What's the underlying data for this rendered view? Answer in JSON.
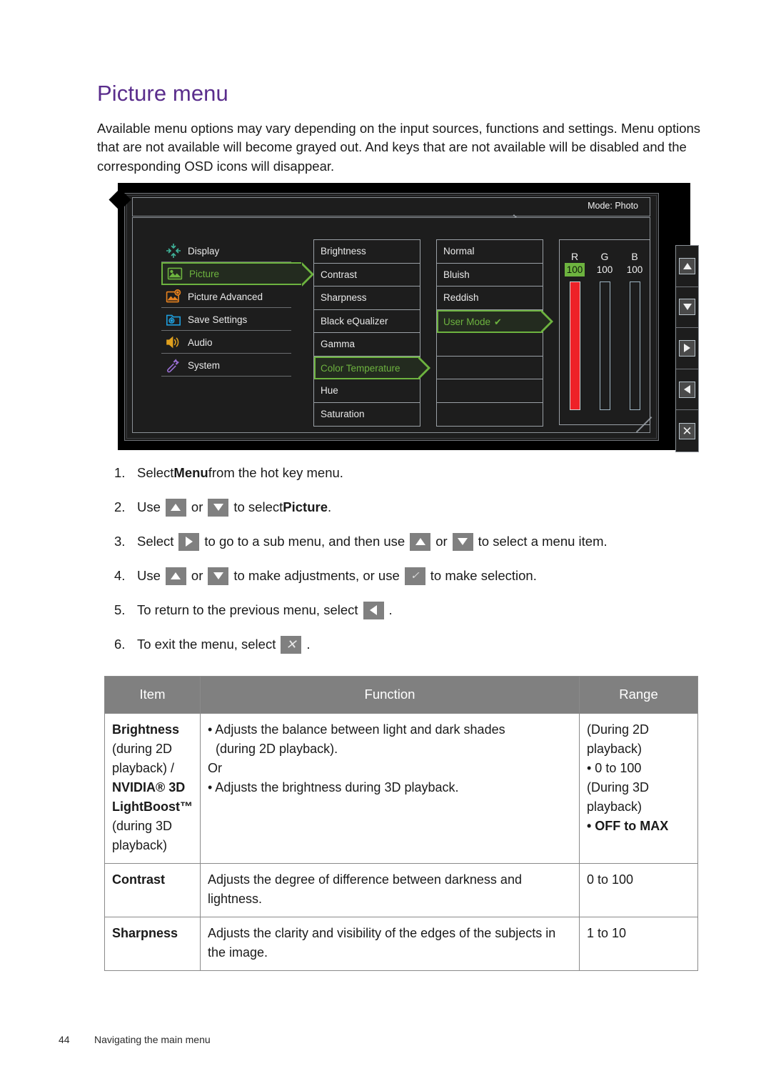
{
  "page": {
    "title": "Picture menu",
    "intro": "Available menu options may vary depending on the input sources, functions and settings. Menu options that are not available will become grayed out. And keys that are not available will be disabled and the corresponding OSD icons will disappear.",
    "footer_page_number": "44",
    "footer_text": "Navigating the main menu",
    "title_color": "#5a2d8c"
  },
  "osd": {
    "mode_label": "Mode: Photo",
    "highlight_color": "#6db33f",
    "sidebar": [
      {
        "label": "Display",
        "icon": "display-shrink-icon",
        "color": "#3fb39a",
        "selected": false
      },
      {
        "label": "Picture",
        "icon": "picture-image-icon",
        "color": "#6db33f",
        "selected": true
      },
      {
        "label": "Picture Advanced",
        "icon": "picture-advanced-icon",
        "color": "#e8821e",
        "selected": false
      },
      {
        "label": "Save Settings",
        "icon": "save-folder-icon",
        "color": "#1e9ddb",
        "selected": false
      },
      {
        "label": "Audio",
        "icon": "speaker-icon",
        "color": "#e0a01e",
        "selected": false
      },
      {
        "label": "System",
        "icon": "wrench-icon",
        "color": "#9a6fd4",
        "selected": false
      }
    ],
    "submenu": [
      {
        "label": "Brightness",
        "selected": false
      },
      {
        "label": "Contrast",
        "selected": false
      },
      {
        "label": "Sharpness",
        "selected": false
      },
      {
        "label": "Black eQualizer",
        "selected": false
      },
      {
        "label": "Gamma",
        "selected": false
      },
      {
        "label": "Color Temperature",
        "selected": true
      },
      {
        "label": "Hue",
        "selected": false
      },
      {
        "label": "Saturation",
        "selected": false
      }
    ],
    "options": [
      {
        "label": "Normal",
        "selected": false,
        "checked": false
      },
      {
        "label": "Bluish",
        "selected": false,
        "checked": false
      },
      {
        "label": "Reddish",
        "selected": false,
        "checked": false
      },
      {
        "label": "User Mode",
        "selected": true,
        "checked": true
      },
      {
        "label": "",
        "selected": false,
        "checked": false
      },
      {
        "label": "",
        "selected": false,
        "checked": false
      },
      {
        "label": "",
        "selected": false,
        "checked": false
      },
      {
        "label": "",
        "selected": false,
        "checked": false
      }
    ],
    "rgb": [
      {
        "letter": "R",
        "value": "100",
        "highlighted": true,
        "bar_filled": true,
        "bar_color": "#ee2128"
      },
      {
        "letter": "G",
        "value": "100",
        "highlighted": false,
        "bar_filled": false,
        "bar_color": "#9fb6c4"
      },
      {
        "letter": "B",
        "value": "100",
        "highlighted": false,
        "bar_filled": false,
        "bar_color": "#9fb6c4"
      }
    ],
    "controls": [
      {
        "icon": "arrow-up-icon"
      },
      {
        "icon": "arrow-down-icon"
      },
      {
        "icon": "arrow-right-icon"
      },
      {
        "icon": "arrow-left-icon"
      },
      {
        "icon": "close-x-icon"
      }
    ]
  },
  "steps": [
    {
      "num": "1.",
      "parts": [
        {
          "t": "text",
          "v": "Select "
        },
        {
          "t": "bold",
          "v": "Menu"
        },
        {
          "t": "text",
          "v": " from the hot key menu."
        }
      ]
    },
    {
      "num": "2.",
      "parts": [
        {
          "t": "text",
          "v": "Use "
        },
        {
          "t": "key",
          "v": "arrow-up-icon"
        },
        {
          "t": "text",
          "v": " or "
        },
        {
          "t": "key",
          "v": "arrow-down-icon"
        },
        {
          "t": "text",
          "v": " to select "
        },
        {
          "t": "bold",
          "v": "Picture"
        },
        {
          "t": "text",
          "v": "."
        }
      ]
    },
    {
      "num": "3.",
      "parts": [
        {
          "t": "text",
          "v": "Select "
        },
        {
          "t": "key",
          "v": "arrow-right-icon"
        },
        {
          "t": "text",
          "v": " to go to a sub menu, and then use "
        },
        {
          "t": "key",
          "v": "arrow-up-icon"
        },
        {
          "t": "text",
          "v": " or "
        },
        {
          "t": "key",
          "v": "arrow-down-icon"
        },
        {
          "t": "text",
          "v": " to select a menu item."
        }
      ]
    },
    {
      "num": "4.",
      "parts": [
        {
          "t": "text",
          "v": "Use "
        },
        {
          "t": "key",
          "v": "arrow-up-icon"
        },
        {
          "t": "text",
          "v": " or "
        },
        {
          "t": "key",
          "v": "arrow-down-icon"
        },
        {
          "t": "text",
          "v": " to make adjustments, or use "
        },
        {
          "t": "key",
          "v": "check-icon"
        },
        {
          "t": "text",
          "v": " to make selection."
        }
      ]
    },
    {
      "num": "5.",
      "parts": [
        {
          "t": "text",
          "v": "To return to the previous menu, select "
        },
        {
          "t": "key",
          "v": "arrow-left-icon"
        },
        {
          "t": "text",
          "v": "."
        }
      ]
    },
    {
      "num": "6.",
      "parts": [
        {
          "t": "text",
          "v": "To exit the menu, select "
        },
        {
          "t": "key",
          "v": "close-x-icon"
        },
        {
          "t": "text",
          "v": "."
        }
      ]
    }
  ],
  "table": {
    "headers": [
      "Item",
      "Function",
      "Range"
    ],
    "rows": [
      {
        "item_lines": [
          {
            "v": "Brightness",
            "bold": true
          },
          {
            "v": "(during 2D",
            "bold": false
          },
          {
            "v": "playback) /",
            "bold": false
          },
          {
            "v": "NVIDIA® 3D",
            "bold": true
          },
          {
            "v": "LightBoost™",
            "bold": true
          },
          {
            "v": "(during 3D",
            "bold": false
          },
          {
            "v": "playback)",
            "bold": false
          }
        ],
        "function_lines": [
          {
            "style": "bullet",
            "v": "Adjusts the balance between light and dark shades"
          },
          {
            "style": "sub",
            "v": "(during 2D playback)."
          },
          {
            "style": "plain",
            "v": "Or"
          },
          {
            "style": "bullet",
            "v": "Adjusts the brightness during 3D playback."
          }
        ],
        "range_lines": [
          {
            "v": "(During 2D"
          },
          {
            "v": "playback)"
          },
          {
            "v": "• 0 to 100"
          },
          {
            "v": "(During 3D"
          },
          {
            "v": "playback)"
          },
          {
            "v": "• OFF to MAX",
            "bold": true
          }
        ]
      },
      {
        "item_lines": [
          {
            "v": "Contrast",
            "bold": true
          }
        ],
        "function_lines": [
          {
            "style": "plain",
            "v": "Adjusts the degree of difference between darkness and lightness."
          }
        ],
        "range_lines": [
          {
            "v": "0 to 100"
          }
        ]
      },
      {
        "item_lines": [
          {
            "v": "Sharpness",
            "bold": true
          }
        ],
        "function_lines": [
          {
            "style": "plain",
            "v": "Adjusts the clarity and visibility of the edges of the subjects in the image."
          }
        ],
        "range_lines": [
          {
            "v": "1 to 10"
          }
        ]
      }
    ]
  }
}
